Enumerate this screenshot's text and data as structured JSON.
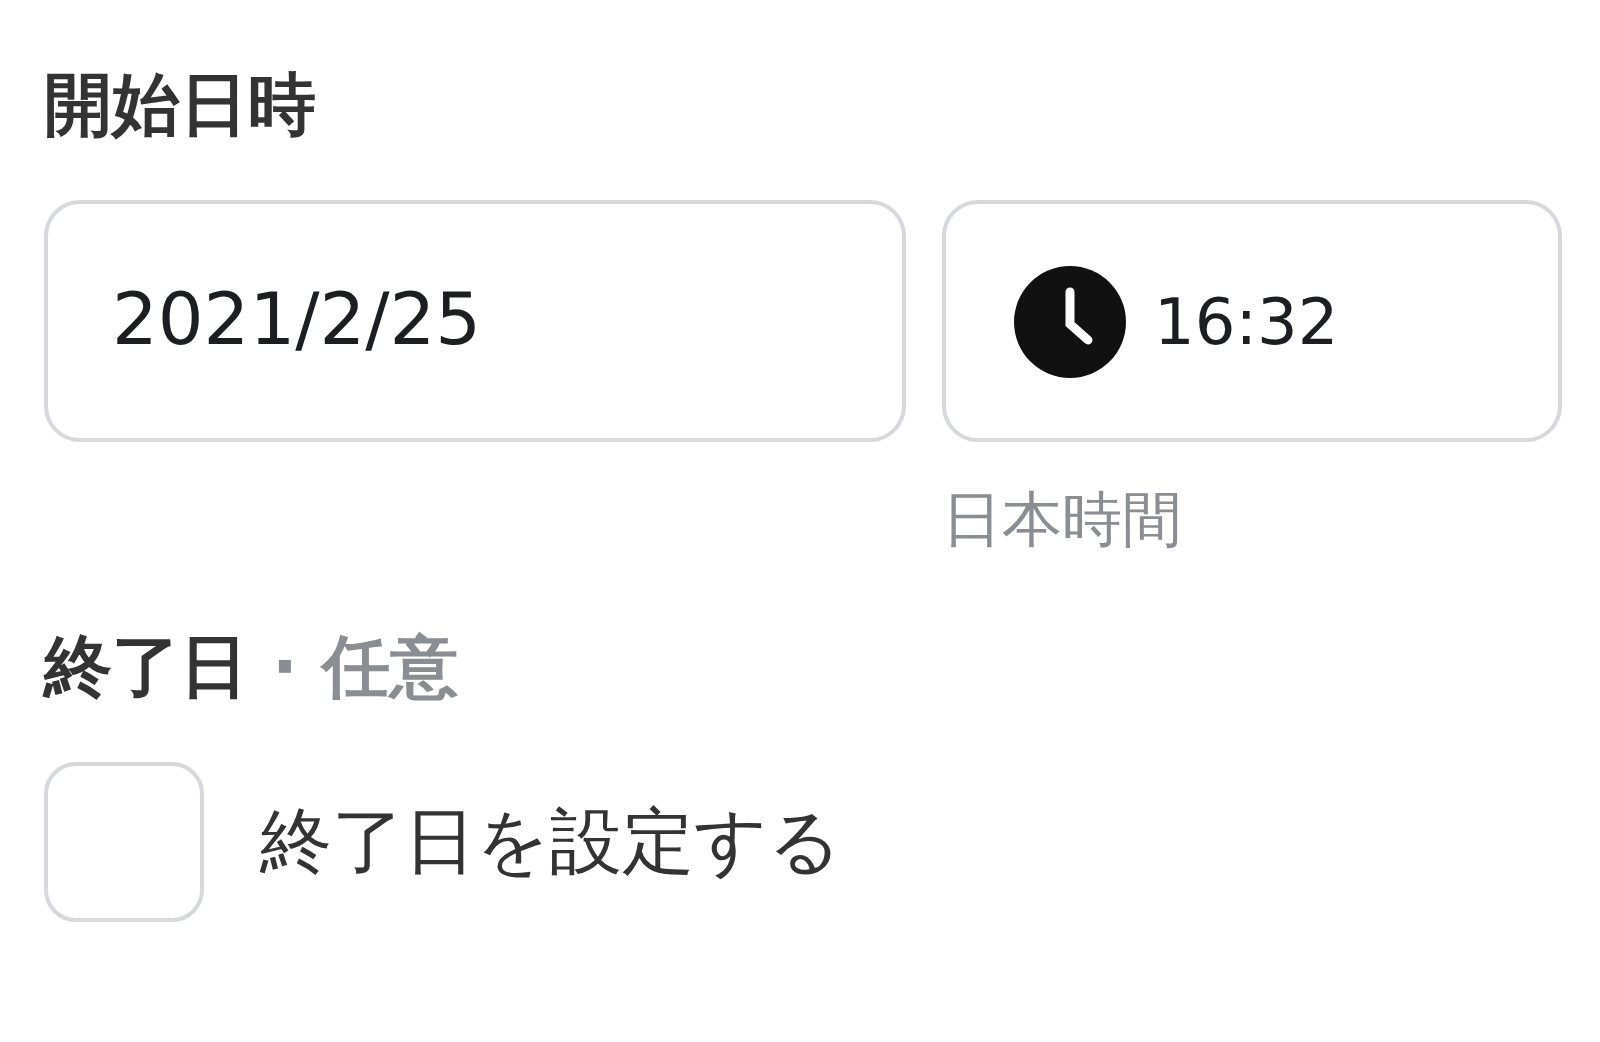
{
  "start": {
    "label": "開始日時",
    "date": {
      "value": "2021/2/25"
    },
    "time": {
      "value": "16:32"
    },
    "timezone": "日本時間"
  },
  "end": {
    "label": "終了日",
    "optional": "· 任意",
    "checkbox": {
      "label": "終了日を設定する",
      "checked": false
    }
  }
}
